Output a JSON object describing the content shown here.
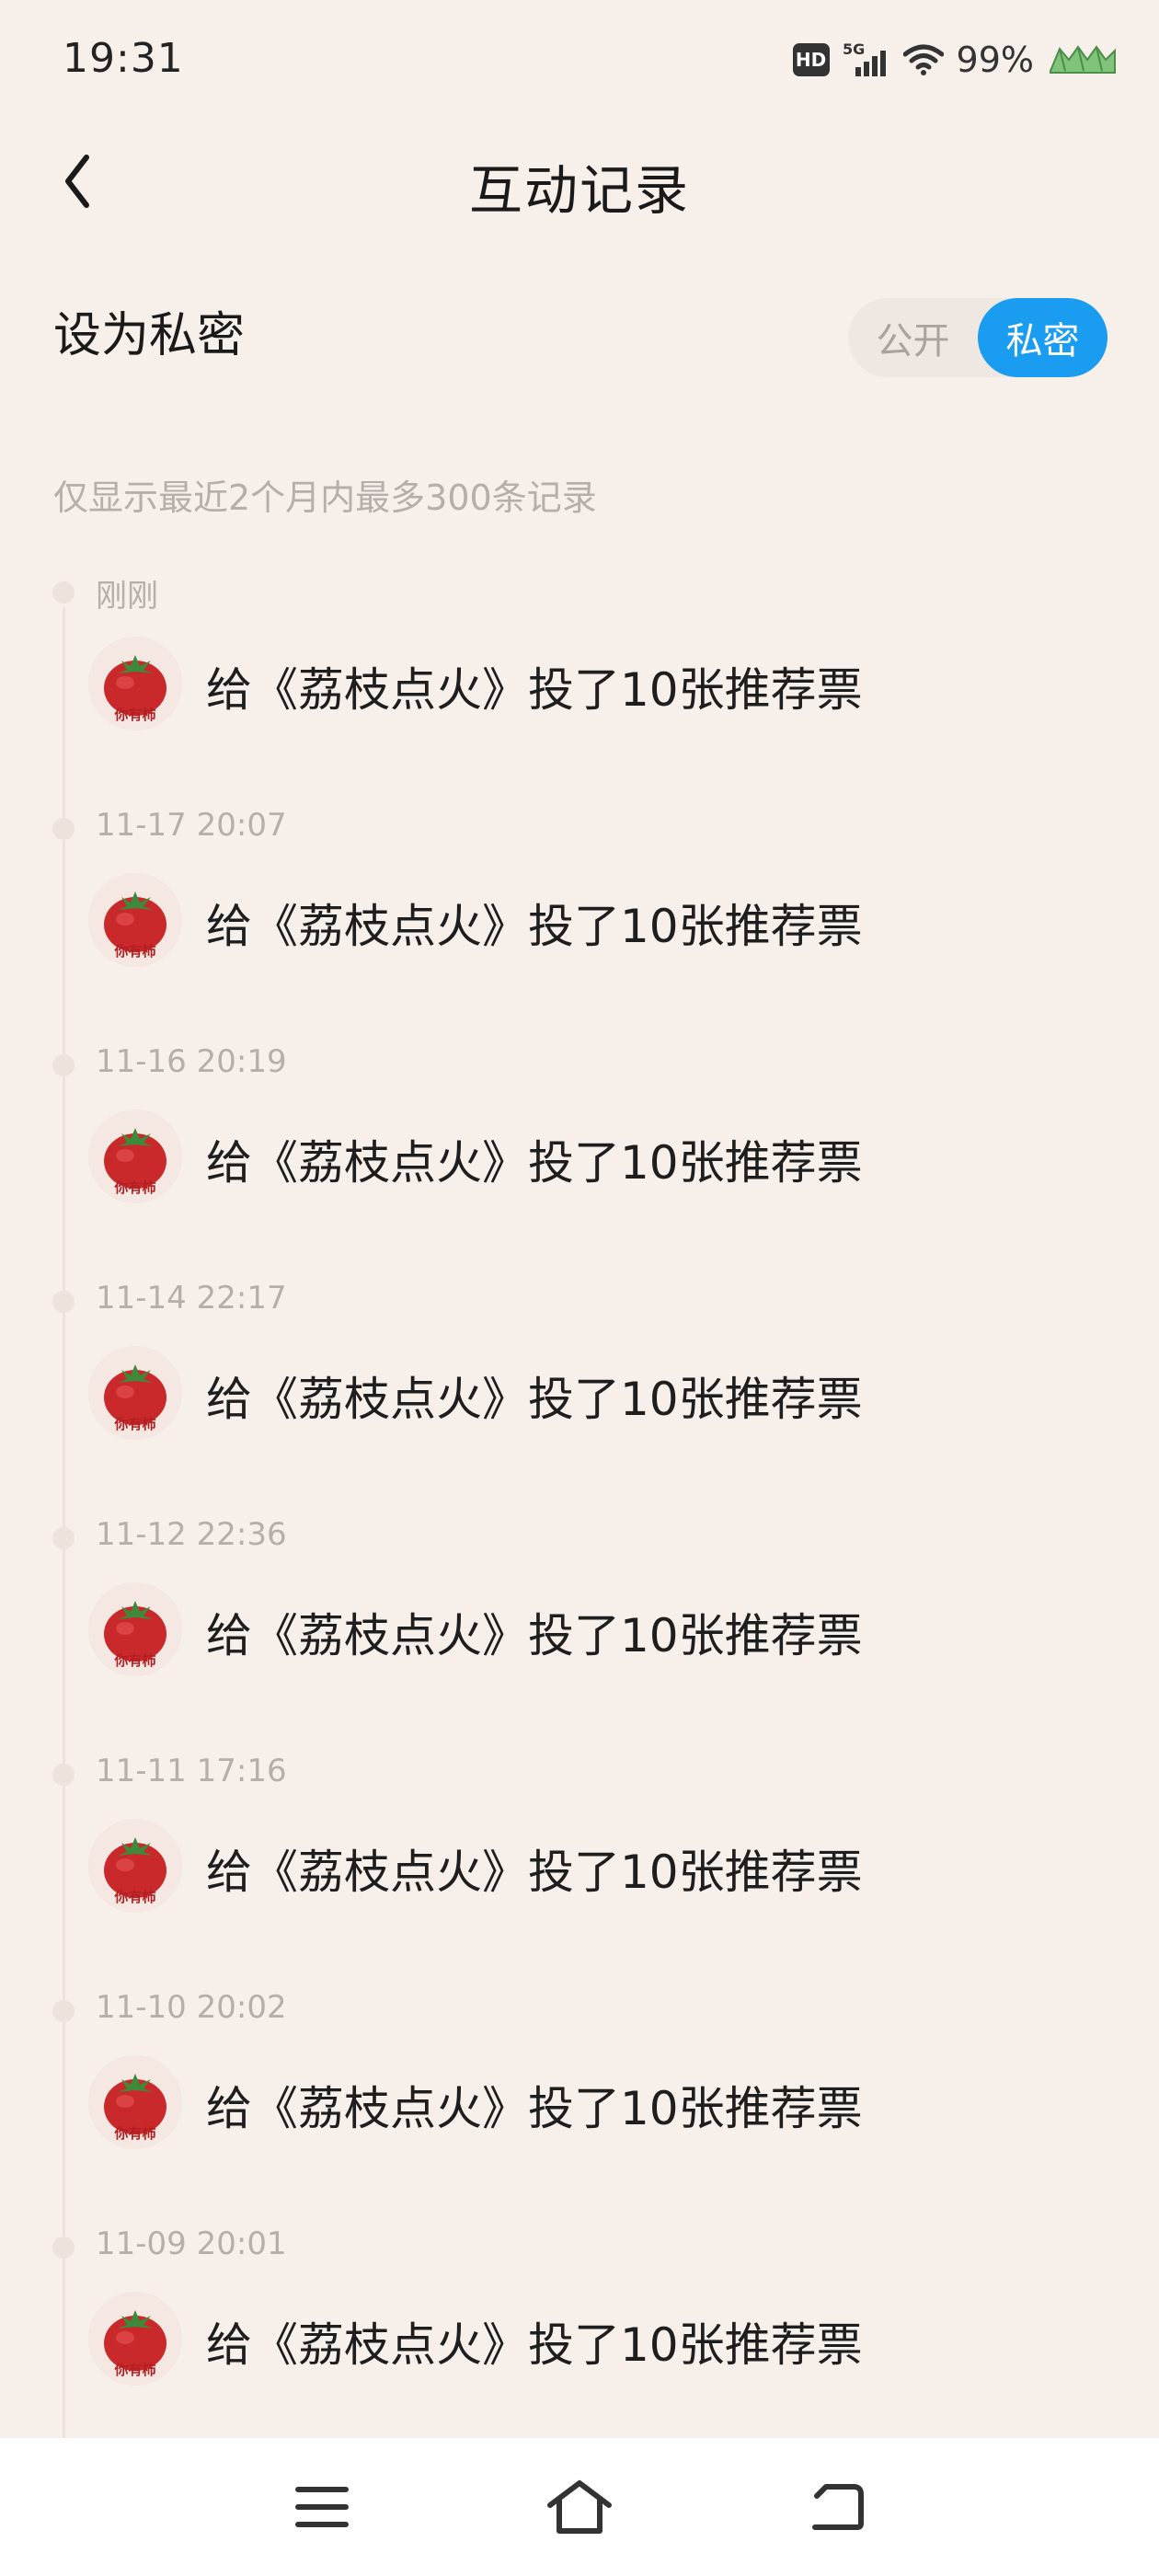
{
  "status_bar": {
    "time": "19:31",
    "hd_label": "HD",
    "network_label": "5G",
    "battery": "99%",
    "icons": [
      "hd-icon",
      "signal-5g-icon",
      "wifi-icon",
      "battery-icon"
    ]
  },
  "header": {
    "title": "互动记录",
    "back_icon": "chevron-left-icon"
  },
  "privacy": {
    "label": "设为私密",
    "options": [
      "公开",
      "私密"
    ],
    "selected": "私密",
    "accent_color": "#1a9cf0"
  },
  "notice": "仅显示最近2个月内最多300条记录",
  "records": [
    {
      "time": "刚刚",
      "text": "给《荔枝点火》投了10张推荐票"
    },
    {
      "time": "11-17 20:07",
      "text": "给《荔枝点火》投了10张推荐票"
    },
    {
      "time": "11-16 20:19",
      "text": "给《荔枝点火》投了10张推荐票"
    },
    {
      "time": "11-14 22:17",
      "text": "给《荔枝点火》投了10张推荐票"
    },
    {
      "time": "11-12 22:36",
      "text": "给《荔枝点火》投了10张推荐票"
    },
    {
      "time": "11-11 17:16",
      "text": "给《荔枝点火》投了10张推荐票"
    },
    {
      "time": "11-10 20:02",
      "text": "给《荔枝点火》投了10张推荐票"
    },
    {
      "time": "11-09 20:01",
      "text": "给《荔枝点火》投了10张推荐票"
    }
  ],
  "avatar": {
    "icon": "tomato-avatar-icon",
    "caption": "你有柿"
  },
  "nav": {
    "icons": [
      "menu-icon",
      "home-icon",
      "back-icon"
    ]
  },
  "colors": {
    "background": "#f7efe9",
    "timestamp": "#b5aeaa"
  }
}
